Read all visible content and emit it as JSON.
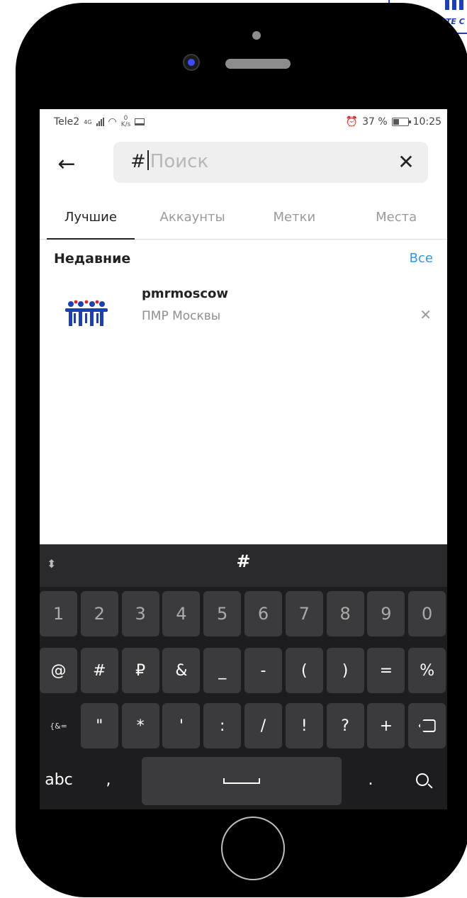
{
  "status_bar": {
    "carrier": "Tele2",
    "network": "4G",
    "net_speed_value": "0",
    "net_speed_unit": "K/s",
    "battery": "37 %",
    "time": "10:25"
  },
  "search": {
    "value": "#",
    "placeholder": "Поиск"
  },
  "tabs": [
    {
      "label": "Лучшие",
      "active": true
    },
    {
      "label": "Аккаунты",
      "active": false
    },
    {
      "label": "Метки",
      "active": false
    },
    {
      "label": "Места",
      "active": false
    }
  ],
  "recent": {
    "title": "Недавние",
    "see_all": "Все",
    "items": [
      {
        "username": "pmrmoscow",
        "full_name": "ПМР Москвы"
      }
    ]
  },
  "keyboard": {
    "suggestion": "#",
    "row1": [
      "1",
      "2",
      "3",
      "4",
      "5",
      "6",
      "7",
      "8",
      "9",
      "0"
    ],
    "row2": [
      "@",
      "#",
      "₽",
      "&",
      "_",
      "-",
      "(",
      ")",
      "=",
      "%"
    ],
    "row3": [
      "{&=",
      "\"",
      "*",
      "'",
      ":",
      "/",
      "!",
      "?",
      "+"
    ],
    "abc": "abc",
    "comma": ",",
    "period": "."
  },
  "corner_logo": {
    "text": "ВМЕСТЕ С"
  },
  "colors": {
    "accent_link": "#2a9ae5",
    "logo_blue": "#1b3fb6",
    "keyboard_bg": "#1d1d1f",
    "key_bg": "#3b3b3e"
  }
}
